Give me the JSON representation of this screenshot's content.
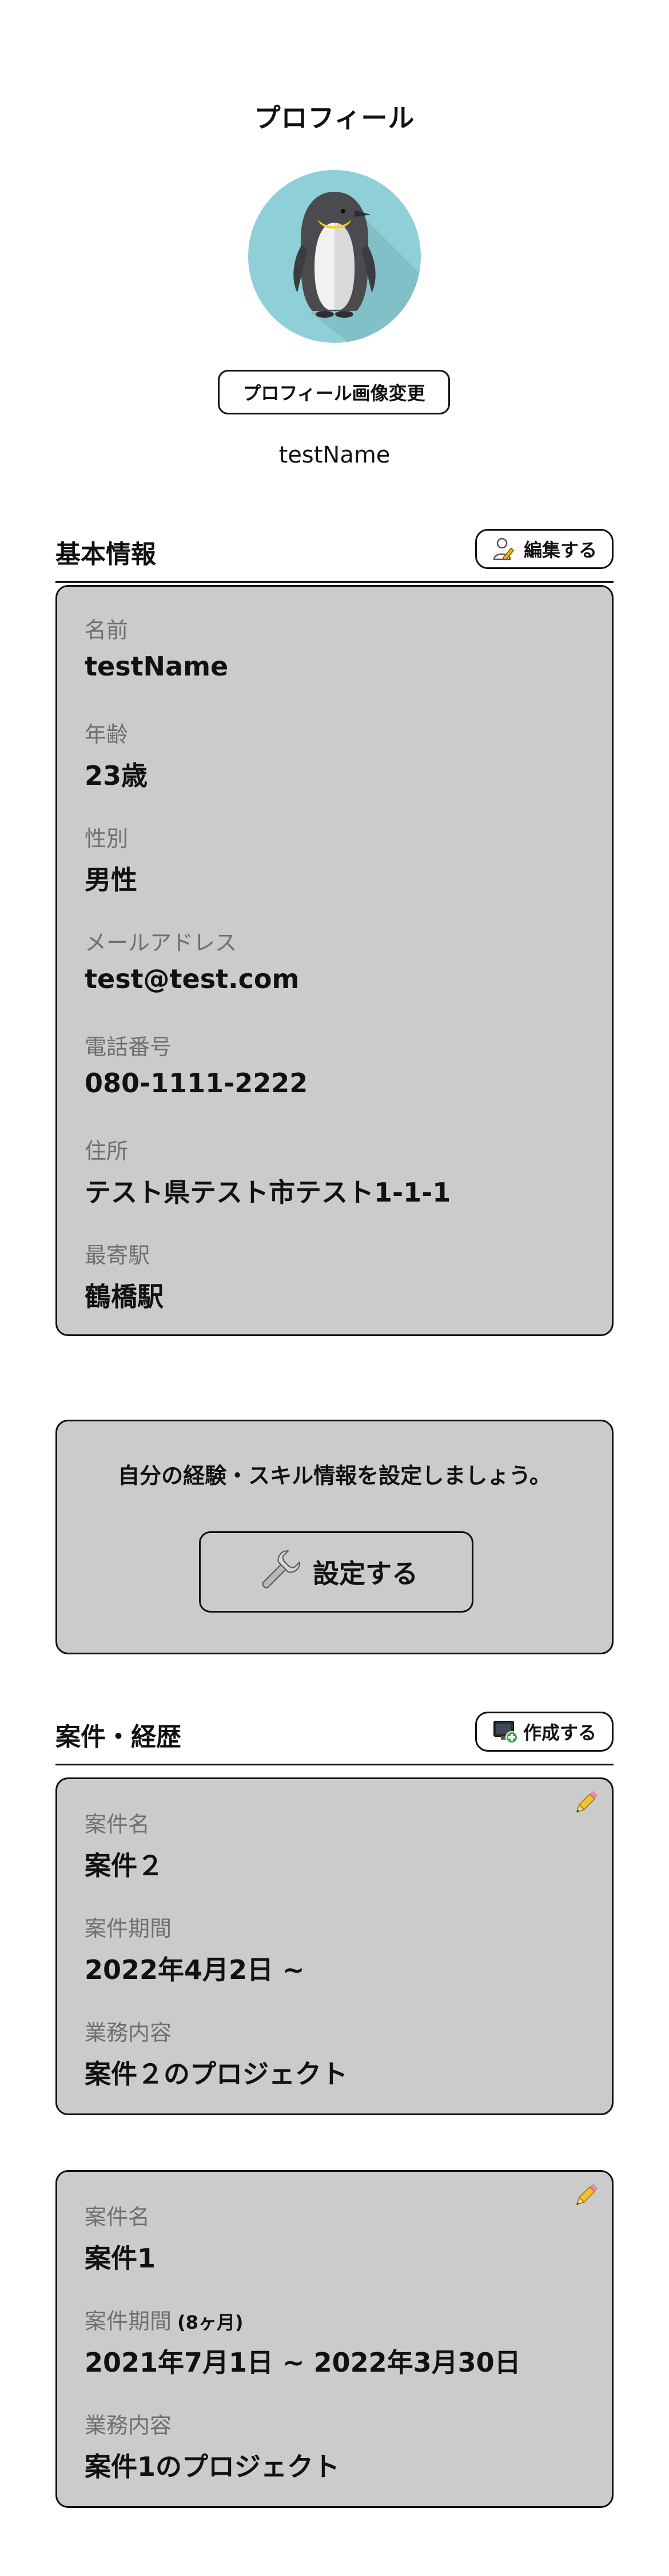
{
  "header": {
    "title": "プロフィール"
  },
  "profile": {
    "change_photo_label": "プロフィール画像変更",
    "display_name": "testName"
  },
  "basic_info": {
    "title": "基本情報",
    "edit_label": "編集する",
    "fields": [
      {
        "label": "名前",
        "value": "testName"
      },
      {
        "label": "年齢",
        "value": "23歳"
      },
      {
        "label": "性別",
        "value": "男性"
      },
      {
        "label": "メールアドレス",
        "value": "test@test.com"
      },
      {
        "label": "電話番号",
        "value": "080-1111-2222"
      },
      {
        "label": "住所",
        "value": "テスト県テスト市テスト1-1-1"
      },
      {
        "label": "最寄駅",
        "value": "鶴橋駅"
      }
    ]
  },
  "skills": {
    "prompt": "自分の経験・スキル情報を設定しましょう。",
    "button_label": "設定する"
  },
  "projects": {
    "title": "案件・経歴",
    "create_label": "作成する",
    "items": [
      {
        "name_label": "案件名",
        "name": "案件２",
        "period_label": "案件期間",
        "period_note": "",
        "period": "2022年4月2日 ~",
        "content_label": "業務内容",
        "content": "案件２のプロジェクト"
      },
      {
        "name_label": "案件名",
        "name": "案件1",
        "period_label": "案件期間",
        "period_note": "(8ヶ月)",
        "period": "2021年7月1日 ~ 2022年3月30日",
        "content_label": "業務内容",
        "content": "案件1のプロジェクト"
      }
    ]
  },
  "colors": {
    "card_background": "#cbcbcb",
    "avatar_circle": "#8fd0d8",
    "label_gray": "#6f6f6f"
  },
  "icons": {
    "avatar": "penguin-avatar",
    "edit": "user-edit-icon",
    "create": "monitor-add-icon",
    "skill": "wrench-icon",
    "project_edit": "pencil-icon"
  }
}
